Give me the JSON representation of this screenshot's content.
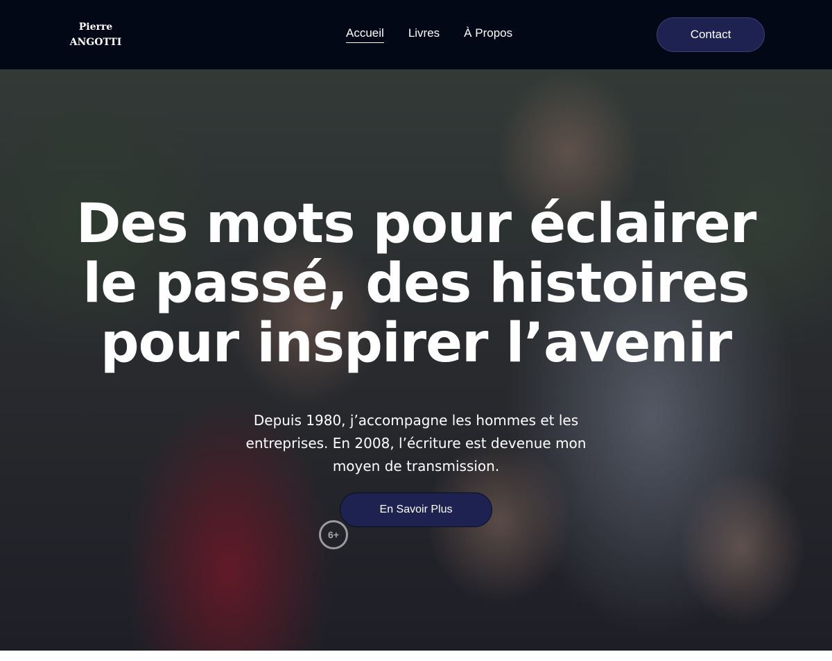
{
  "header": {
    "logo": {
      "line1": "Pierre",
      "line2": "ANGOTTI"
    },
    "nav": [
      {
        "label": "Accueil",
        "active": true
      },
      {
        "label": "Livres",
        "active": false
      },
      {
        "label": "À Propos",
        "active": false
      }
    ],
    "contact_label": "Contact"
  },
  "hero": {
    "title": "Des mots pour éclairer le passé, des histoires pour inspirer l’avenir",
    "subtitle": "Depuis 1980, j’accompagne les hommes et les entreprises. En 2008, l’écriture est devenue mon moyen de transmission.",
    "cta_label": "En Savoir Plus",
    "badge_text": "6+",
    "image": "family-photo"
  },
  "colors": {
    "header_bg": "#030816",
    "button_bg": "#1d2250",
    "text": "#ffffff"
  }
}
